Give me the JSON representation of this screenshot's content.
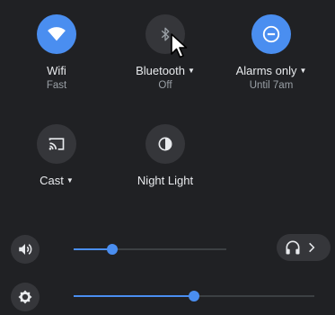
{
  "toggles": {
    "wifi": {
      "label": "Wifi",
      "sublabel": "Fast",
      "state": "on",
      "icon": "wifi-icon"
    },
    "bluetooth": {
      "label": "Bluetooth",
      "sublabel": "Off",
      "state": "off",
      "icon": "bluetooth-icon",
      "has_menu": true
    },
    "alarms": {
      "label": "Alarms only",
      "sublabel": "Until 7am",
      "state": "on",
      "icon": "do-not-disturb-icon",
      "has_menu": true
    },
    "cast": {
      "label": "Cast",
      "state": "off",
      "icon": "cast-icon",
      "has_menu": true
    },
    "nightlight": {
      "label": "Night Light",
      "state": "off",
      "icon": "night-light-icon"
    }
  },
  "volume": {
    "icon": "volume-icon",
    "level": 0.25
  },
  "brightness": {
    "icon": "brightness-icon",
    "level": 0.5
  },
  "audio_output": {
    "icon": "headphones-icon",
    "chevron": "chevron-right-icon"
  },
  "colors": {
    "background": "#202124",
    "accent": "#4a8ef0",
    "button_off": "#35363a",
    "text": "#e8eaed",
    "subtext": "#9aa0a6"
  }
}
